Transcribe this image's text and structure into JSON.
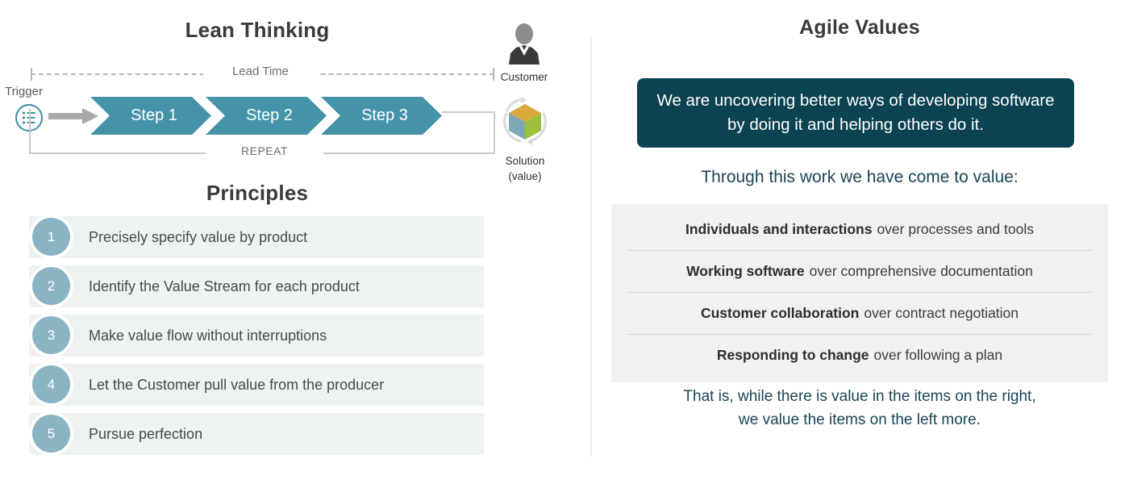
{
  "left": {
    "title": "Lean Thinking",
    "diagram": {
      "lead_time_label": "Lead Time",
      "trigger_label": "Trigger",
      "repeat_label": "REPEAT",
      "trigger_icon": "checklist-circle-icon",
      "arrow_icon": "right-arrow-icon",
      "steps": [
        {
          "label": "Step 1"
        },
        {
          "label": "Step 2"
        },
        {
          "label": "Step 3"
        }
      ],
      "customer": {
        "icon": "person-icon",
        "caption": "Customer"
      },
      "solution": {
        "icon": "cube-refresh-icon",
        "caption_line1": "Solution",
        "caption_line2": "(value)"
      }
    },
    "principles_title": "Principles",
    "principles": [
      {
        "number": "1",
        "text": "Precisely specify value by product"
      },
      {
        "number": "2",
        "text": "Identify the Value Stream for each product"
      },
      {
        "number": "3",
        "text": "Make value flow without interruptions"
      },
      {
        "number": "4",
        "text": "Let the Customer pull value from the producer"
      },
      {
        "number": "5",
        "text": "Pursue perfection"
      }
    ]
  },
  "right": {
    "title": "Agile Values",
    "manifesto": "We are uncovering better ways of developing software by doing it and helping others do it.",
    "come_to_value": "Through this work we have come to value:",
    "values": [
      {
        "bold": "Individuals and interactions",
        "rest": "over processes and tools"
      },
      {
        "bold": "Working software",
        "rest": "over comprehensive documentation"
      },
      {
        "bold": "Customer collaboration",
        "rest": "over contract negotiation"
      },
      {
        "bold": "Responding to change",
        "rest": "over following a plan"
      }
    ],
    "closing_line1": "That is, while there is value in the items on the right,",
    "closing_line2": "we value the items on the left more."
  },
  "colors": {
    "step_teal": "#4593a8",
    "principle_circle": "#8ab4c4",
    "principle_row_bg": "#eef2f3",
    "manifesto_bg": "#0c4352",
    "values_bg": "#f1f1f1",
    "accent_dark": "#184556",
    "cube_top": "#d9a93e",
    "cube_left": "#7ca9b5",
    "cube_right": "#9dc03c"
  }
}
